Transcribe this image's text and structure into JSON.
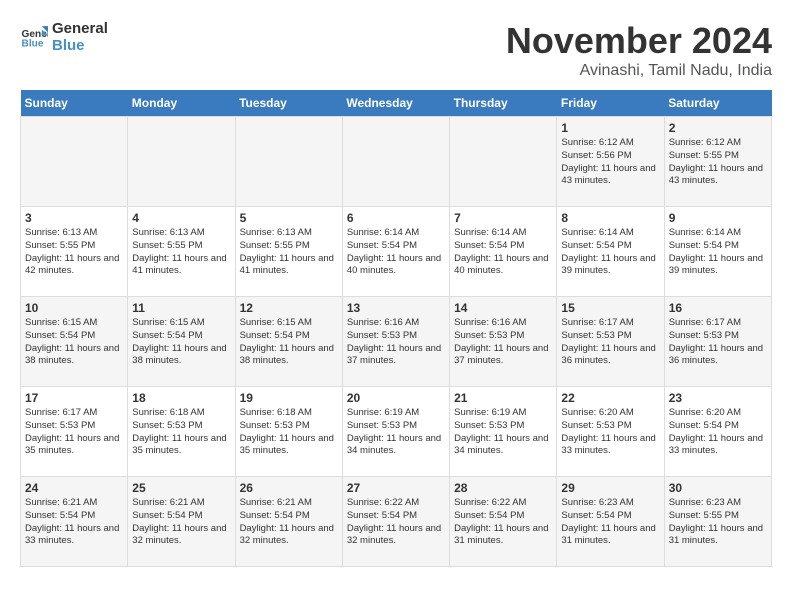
{
  "logo": {
    "text_general": "General",
    "text_blue": "Blue"
  },
  "title": "November 2024",
  "subtitle": "Avinashi, Tamil Nadu, India",
  "days_of_week": [
    "Sunday",
    "Monday",
    "Tuesday",
    "Wednesday",
    "Thursday",
    "Friday",
    "Saturday"
  ],
  "weeks": [
    [
      {
        "day": "",
        "info": ""
      },
      {
        "day": "",
        "info": ""
      },
      {
        "day": "",
        "info": ""
      },
      {
        "day": "",
        "info": ""
      },
      {
        "day": "",
        "info": ""
      },
      {
        "day": "1",
        "info": "Sunrise: 6:12 AM\nSunset: 5:56 PM\nDaylight: 11 hours and 43 minutes."
      },
      {
        "day": "2",
        "info": "Sunrise: 6:12 AM\nSunset: 5:55 PM\nDaylight: 11 hours and 43 minutes."
      }
    ],
    [
      {
        "day": "3",
        "info": "Sunrise: 6:13 AM\nSunset: 5:55 PM\nDaylight: 11 hours and 42 minutes."
      },
      {
        "day": "4",
        "info": "Sunrise: 6:13 AM\nSunset: 5:55 PM\nDaylight: 11 hours and 41 minutes."
      },
      {
        "day": "5",
        "info": "Sunrise: 6:13 AM\nSunset: 5:55 PM\nDaylight: 11 hours and 41 minutes."
      },
      {
        "day": "6",
        "info": "Sunrise: 6:14 AM\nSunset: 5:54 PM\nDaylight: 11 hours and 40 minutes."
      },
      {
        "day": "7",
        "info": "Sunrise: 6:14 AM\nSunset: 5:54 PM\nDaylight: 11 hours and 40 minutes."
      },
      {
        "day": "8",
        "info": "Sunrise: 6:14 AM\nSunset: 5:54 PM\nDaylight: 11 hours and 39 minutes."
      },
      {
        "day": "9",
        "info": "Sunrise: 6:14 AM\nSunset: 5:54 PM\nDaylight: 11 hours and 39 minutes."
      }
    ],
    [
      {
        "day": "10",
        "info": "Sunrise: 6:15 AM\nSunset: 5:54 PM\nDaylight: 11 hours and 38 minutes."
      },
      {
        "day": "11",
        "info": "Sunrise: 6:15 AM\nSunset: 5:54 PM\nDaylight: 11 hours and 38 minutes."
      },
      {
        "day": "12",
        "info": "Sunrise: 6:15 AM\nSunset: 5:54 PM\nDaylight: 11 hours and 38 minutes."
      },
      {
        "day": "13",
        "info": "Sunrise: 6:16 AM\nSunset: 5:53 PM\nDaylight: 11 hours and 37 minutes."
      },
      {
        "day": "14",
        "info": "Sunrise: 6:16 AM\nSunset: 5:53 PM\nDaylight: 11 hours and 37 minutes."
      },
      {
        "day": "15",
        "info": "Sunrise: 6:17 AM\nSunset: 5:53 PM\nDaylight: 11 hours and 36 minutes."
      },
      {
        "day": "16",
        "info": "Sunrise: 6:17 AM\nSunset: 5:53 PM\nDaylight: 11 hours and 36 minutes."
      }
    ],
    [
      {
        "day": "17",
        "info": "Sunrise: 6:17 AM\nSunset: 5:53 PM\nDaylight: 11 hours and 35 minutes."
      },
      {
        "day": "18",
        "info": "Sunrise: 6:18 AM\nSunset: 5:53 PM\nDaylight: 11 hours and 35 minutes."
      },
      {
        "day": "19",
        "info": "Sunrise: 6:18 AM\nSunset: 5:53 PM\nDaylight: 11 hours and 35 minutes."
      },
      {
        "day": "20",
        "info": "Sunrise: 6:19 AM\nSunset: 5:53 PM\nDaylight: 11 hours and 34 minutes."
      },
      {
        "day": "21",
        "info": "Sunrise: 6:19 AM\nSunset: 5:53 PM\nDaylight: 11 hours and 34 minutes."
      },
      {
        "day": "22",
        "info": "Sunrise: 6:20 AM\nSunset: 5:53 PM\nDaylight: 11 hours and 33 minutes."
      },
      {
        "day": "23",
        "info": "Sunrise: 6:20 AM\nSunset: 5:54 PM\nDaylight: 11 hours and 33 minutes."
      }
    ],
    [
      {
        "day": "24",
        "info": "Sunrise: 6:21 AM\nSunset: 5:54 PM\nDaylight: 11 hours and 33 minutes."
      },
      {
        "day": "25",
        "info": "Sunrise: 6:21 AM\nSunset: 5:54 PM\nDaylight: 11 hours and 32 minutes."
      },
      {
        "day": "26",
        "info": "Sunrise: 6:21 AM\nSunset: 5:54 PM\nDaylight: 11 hours and 32 minutes."
      },
      {
        "day": "27",
        "info": "Sunrise: 6:22 AM\nSunset: 5:54 PM\nDaylight: 11 hours and 32 minutes."
      },
      {
        "day": "28",
        "info": "Sunrise: 6:22 AM\nSunset: 5:54 PM\nDaylight: 11 hours and 31 minutes."
      },
      {
        "day": "29",
        "info": "Sunrise: 6:23 AM\nSunset: 5:54 PM\nDaylight: 11 hours and 31 minutes."
      },
      {
        "day": "30",
        "info": "Sunrise: 6:23 AM\nSunset: 5:55 PM\nDaylight: 11 hours and 31 minutes."
      }
    ]
  ]
}
